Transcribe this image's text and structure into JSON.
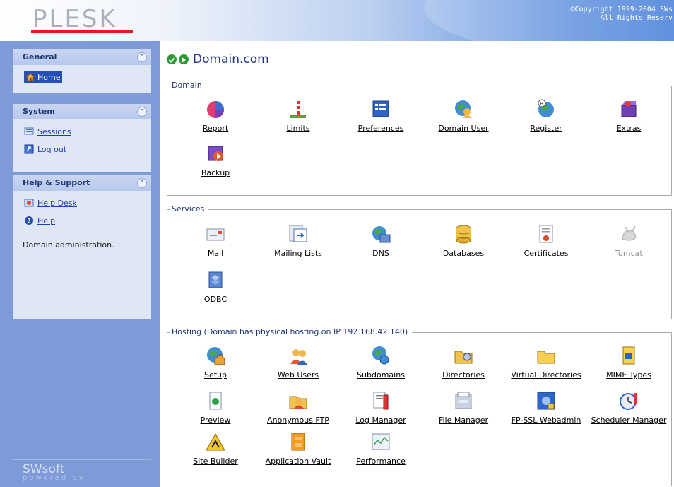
{
  "header": {
    "logo": "PLESK",
    "copyright": "©Copyright 1999-2004 SWs\nAll Rights Reserv"
  },
  "sidebar": {
    "general": {
      "title": "General",
      "items": [
        {
          "label": "Home",
          "icon": "home-icon"
        }
      ]
    },
    "system": {
      "title": "System",
      "items": [
        {
          "label": "Sessions",
          "icon": "sessions-icon"
        },
        {
          "label": "Log out",
          "icon": "logout-icon"
        }
      ]
    },
    "help": {
      "title": "Help & Support",
      "items": [
        {
          "label": "Help Desk",
          "icon": "help-desk-icon"
        },
        {
          "label": "Help",
          "icon": "help-icon"
        }
      ],
      "description": "Domain administration."
    },
    "footer_logo": "SWsoft",
    "footer_tag": "powered by"
  },
  "main": {
    "title": "Domain.com",
    "domain": {
      "legend": "Domain",
      "items": [
        "Report",
        "Limits",
        "Preferences",
        "Domain User",
        "Register",
        "Extras",
        "Backup"
      ]
    },
    "services": {
      "legend": "Services",
      "items": [
        "Mail",
        "Mailing Lists",
        "DNS",
        "Databases",
        "Certificates",
        "Tomcat",
        "ODBC"
      ]
    },
    "hosting": {
      "legend": "Hosting (Domain has physical hosting on IP 192.168.42.140)",
      "items": [
        "Setup",
        "Web Users",
        "Subdomains",
        "Directories",
        "Virtual Directories",
        "MIME Types",
        "Preview",
        "Anonymous FTP",
        "Log Manager",
        "File Manager",
        "FP-SSL Webadmin",
        "Scheduler Manager",
        "Site Builder",
        "Application Vault",
        "Performance"
      ]
    }
  },
  "colors": {
    "sidebar_bg": "#7f9ad8",
    "panel_bg": "#dfe6f5",
    "title_blue": "#1d3388",
    "link_blue": "#1d3fb0",
    "logo_red": "#e21b1b"
  }
}
